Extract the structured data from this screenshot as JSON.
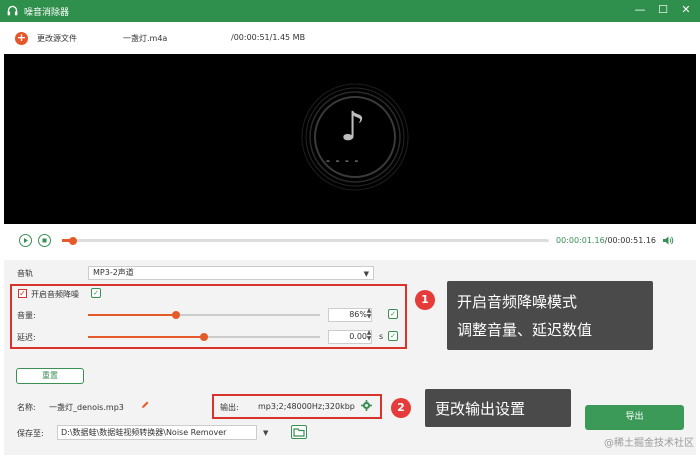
{
  "window": {
    "title": "噪音消除器",
    "minimize": "—",
    "maximize": "☐",
    "close": "✕"
  },
  "toolbar": {
    "add_icon": "plus-icon",
    "change_source_label": "更改源文件",
    "file_name": "一盏灯.m4a",
    "file_info": "/00:00:51/1.45 MB"
  },
  "player": {
    "music_icon": "♪",
    "placeholder": "- - - -"
  },
  "playback": {
    "current_time": "00:00:01.16",
    "total_time": "/00:00:51.16",
    "progress": 0.023
  },
  "audio": {
    "track_label": "音轨",
    "track_value": "MP3-2声道",
    "denoise_label": "开启音频降噪",
    "denoise_checked": true,
    "volume_label": "音量:",
    "volume_value": "86%",
    "volume_level": 0.86,
    "delay_label": "延迟:",
    "delay_value": "0.00",
    "delay_unit": "s",
    "delay_level": 0.5,
    "reset_label": "重置"
  },
  "callouts": [
    {
      "number": "1",
      "line1": "开启音频降噪模式",
      "line2": "调整音量、延迟数值"
    },
    {
      "number": "2",
      "line1": "更改输出设置"
    }
  ],
  "output": {
    "name_label": "名称:",
    "name_value": "一盏灯_denois.mp3",
    "output_label": "输出:",
    "output_value": "mp3;2;48000Hz;320kbp",
    "save_label": "保存至:",
    "save_path": "D:\\数据蛙\\数据蛙视频转换器\\Noise Remover",
    "export_label": "导出"
  },
  "watermark": "@稀土掘金技术社区",
  "colors": {
    "title_bar": "#2f8f4c",
    "accent": "#e55a2a",
    "highlight": "#d9342b",
    "green": "#3a8f55"
  }
}
